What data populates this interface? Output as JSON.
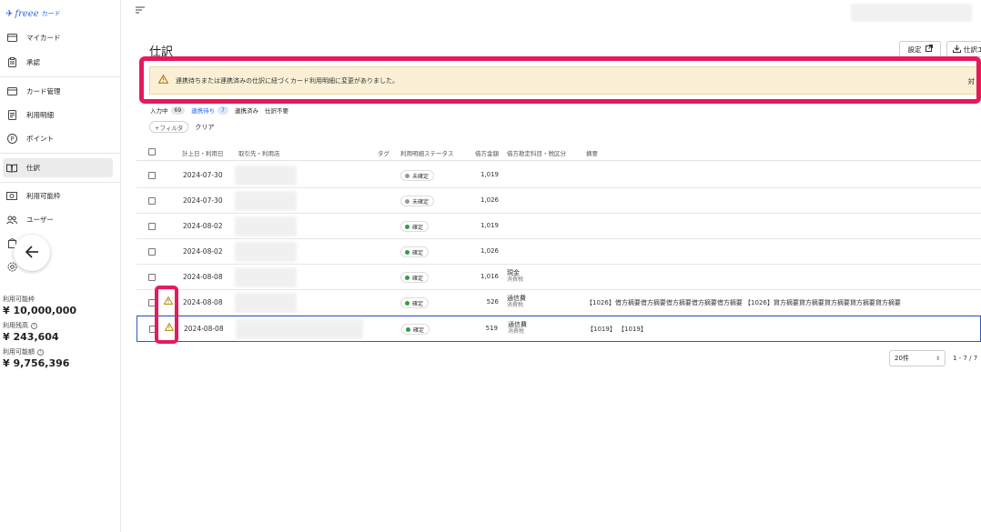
{
  "app": {
    "logo_brand": "freee",
    "logo_sub": "カード"
  },
  "sidebar": {
    "items": [
      {
        "label": "マイカード",
        "icon": "card-icon"
      },
      {
        "label": "承認",
        "icon": "clipboard-icon"
      },
      {
        "label": "カード管理",
        "icon": "card-manage-icon"
      },
      {
        "label": "利用明細",
        "icon": "document-icon"
      },
      {
        "label": "ポイント",
        "icon": "points-icon"
      },
      {
        "label": "仕訳",
        "icon": "book-icon"
      },
      {
        "label": "利用可能枠",
        "icon": "limit-icon"
      },
      {
        "label": "ユーザー",
        "icon": "users-icon"
      }
    ],
    "limits": [
      {
        "label": "利用可能枠",
        "value": "¥ 10,000,000"
      },
      {
        "label": "利用残高",
        "value": "¥ 243,604"
      },
      {
        "label": "利用可能額",
        "value": "¥ 9,756,396"
      }
    ]
  },
  "header": {
    "title": "仕訳",
    "settings_label": "設定",
    "export_label": "仕訳エ"
  },
  "alert": {
    "message": "連携待ちまたは連携済みの仕訳に紐づくカード利用明細に変更がありました。",
    "action_label": "対"
  },
  "tabs": [
    {
      "label": "入力中",
      "count": "69"
    },
    {
      "label": "連携待ち",
      "count": "7"
    },
    {
      "label": "連携済み",
      "count": ""
    },
    {
      "label": "仕訳不要",
      "count": ""
    }
  ],
  "filters": {
    "add_filter_label": "+フィルタ",
    "clear_label": "クリア"
  },
  "table": {
    "headers": {
      "date": "計上日・利用日",
      "partner": "取引先・利用店",
      "tag": "タグ",
      "status": "利用明細ステータス",
      "amount": "借方金額",
      "account": "借方勘定科目・税区分",
      "memo": "摘要"
    },
    "rows": [
      {
        "date": "2024-07-30",
        "status": "未確定",
        "status_color": "#999999",
        "amount": "1,019",
        "account": "",
        "tax": "",
        "memo": "",
        "warn": false
      },
      {
        "date": "2024-07-30",
        "status": "未確定",
        "status_color": "#999999",
        "amount": "1,026",
        "account": "",
        "tax": "",
        "memo": "",
        "warn": false
      },
      {
        "date": "2024-08-02",
        "status": "確定",
        "status_color": "#2ea043",
        "amount": "1,019",
        "account": "",
        "tax": "",
        "memo": "",
        "warn": false
      },
      {
        "date": "2024-08-02",
        "status": "確定",
        "status_color": "#2ea043",
        "amount": "1,026",
        "account": "",
        "tax": "",
        "memo": "",
        "warn": false
      },
      {
        "date": "2024-08-08",
        "status": "確定",
        "status_color": "#2ea043",
        "amount": "1,016",
        "account": "現金",
        "tax": "消費税",
        "memo": "",
        "warn": false
      },
      {
        "date": "2024-08-08",
        "status": "確定",
        "status_color": "#2ea043",
        "amount": "526",
        "account": "通信費",
        "tax": "消費税",
        "memo": "【1026】借方摘要借方摘要借方摘要借方摘要借方摘要 【1026】貸方摘要貸方摘要貸方摘要貸方摘要貸方摘要",
        "warn": true
      },
      {
        "date": "2024-08-08",
        "status": "確定",
        "status_color": "#2ea043",
        "amount": "519",
        "account": "通信費",
        "tax": "消費税",
        "memo": "【1019】 【1019】",
        "warn": true
      }
    ]
  },
  "pagination": {
    "per_page": "20件",
    "range": "1 - 7 / 7"
  }
}
